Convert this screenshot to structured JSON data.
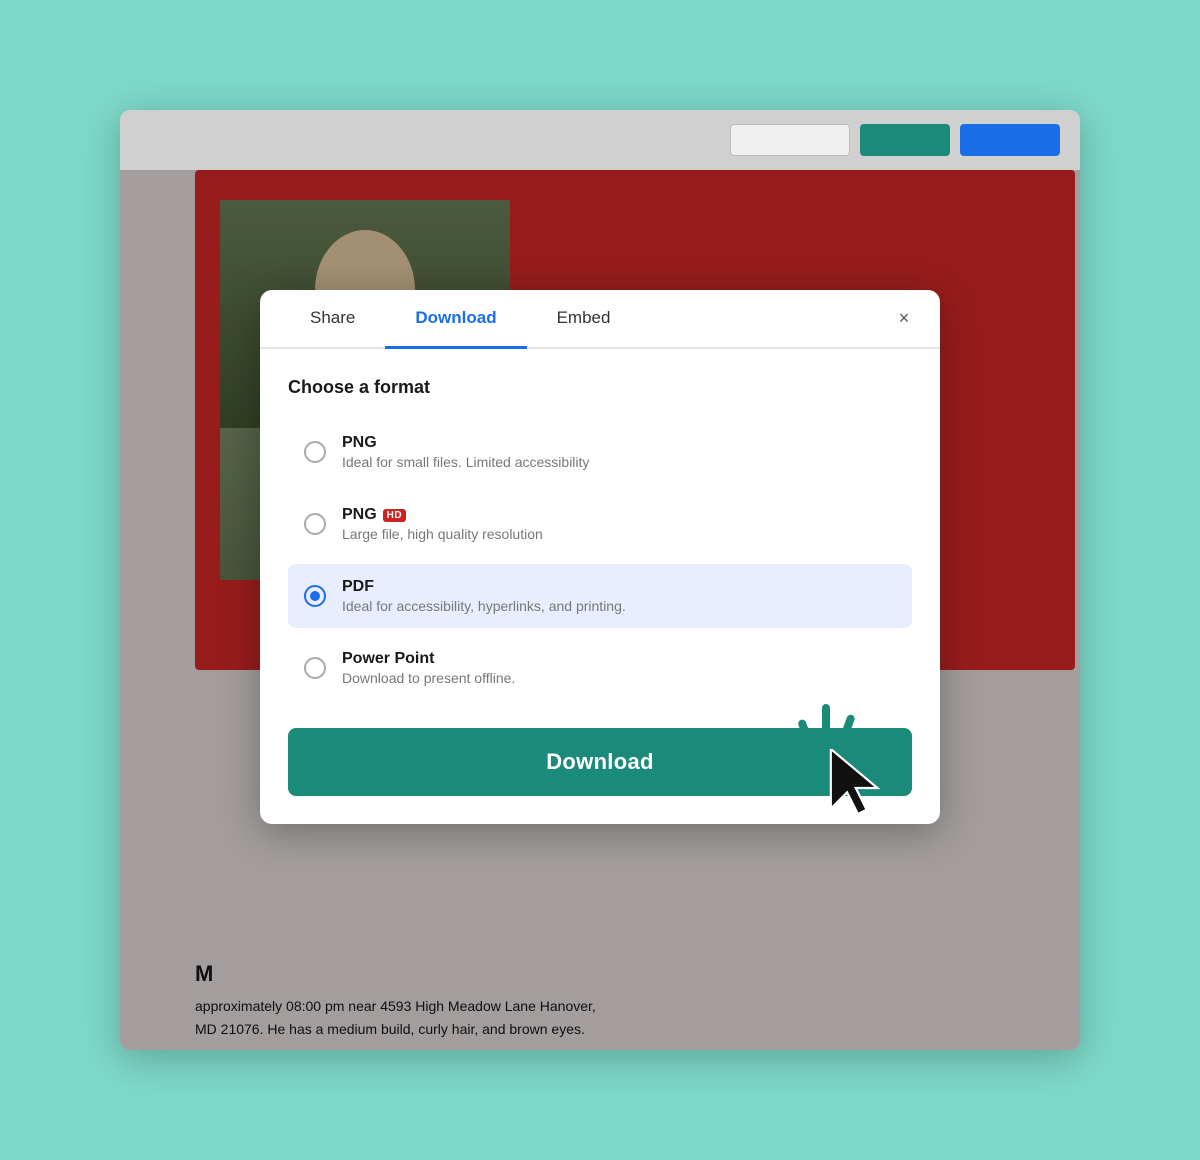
{
  "background_color": "#7dd9c8",
  "toolbar": {
    "input_placeholder": "",
    "btn_teal_label": "",
    "btn_blue_label": ""
  },
  "modal": {
    "tabs": [
      {
        "id": "share",
        "label": "Share",
        "active": false
      },
      {
        "id": "download",
        "label": "Download",
        "active": true
      },
      {
        "id": "embed",
        "label": "Embed",
        "active": false
      }
    ],
    "close_label": "×",
    "section_title": "Choose a format",
    "formats": [
      {
        "id": "png",
        "name": "PNG",
        "badge": null,
        "description": "Ideal for small files. Limited accessibility",
        "selected": false
      },
      {
        "id": "png-hd",
        "name": "PNG",
        "badge": "HD",
        "description": "Large file, high quality resolution",
        "selected": false
      },
      {
        "id": "pdf",
        "name": "PDF",
        "badge": null,
        "description": "Ideal for accessibility, hyperlinks, and printing.",
        "selected": true
      },
      {
        "id": "powerpoint",
        "name": "Power Point",
        "badge": null,
        "description": "Download to present offline.",
        "selected": false
      }
    ],
    "download_button_label": "Download"
  },
  "page_bottom_text": {
    "line1": "M",
    "line2": "approximately 08:00 pm near 4593 High Meadow Lane Hanover,",
    "line3": "MD 21076. He has a medium build, curly hair, and brown eyes."
  }
}
